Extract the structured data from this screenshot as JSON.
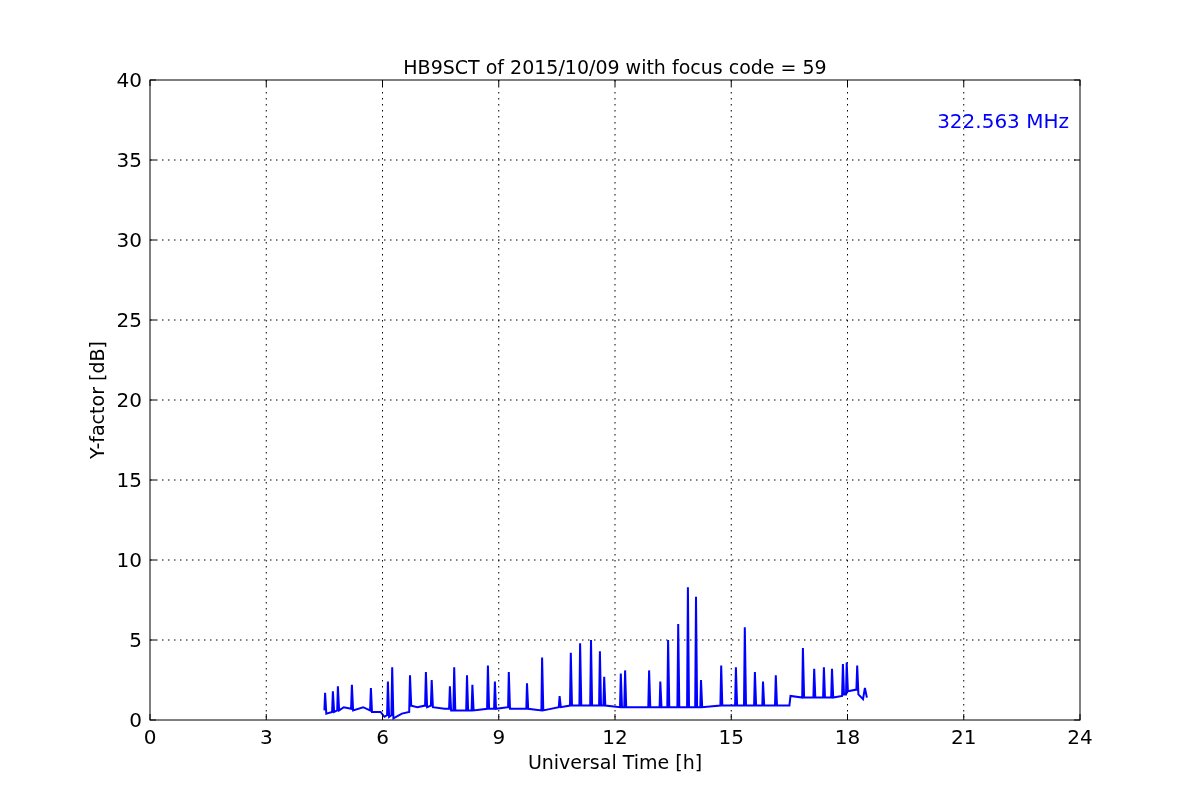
{
  "chart_data": {
    "type": "line",
    "title": "HB9SCT of 2015/10/09 with focus code = 59",
    "xlabel": "Universal Time [h]",
    "ylabel": "Y-factor [dB]",
    "xlim": [
      0,
      24
    ],
    "ylim": [
      0,
      40
    ],
    "grid": true,
    "xticks": [
      0,
      3,
      6,
      9,
      12,
      15,
      18,
      21,
      24
    ],
    "yticks": [
      0,
      5,
      10,
      15,
      20,
      25,
      30,
      35,
      40
    ],
    "x": [
      4.5,
      4.52,
      4.55,
      4.7,
      4.72,
      4.75,
      4.83,
      4.85,
      4.88,
      5.0,
      5.19,
      5.21,
      5.24,
      5.5,
      5.68,
      5.7,
      5.73,
      5.95,
      6.05,
      6.12,
      6.14,
      6.17,
      6.23,
      6.25,
      6.28,
      6.5,
      6.69,
      6.71,
      6.74,
      6.9,
      7.1,
      7.12,
      7.15,
      7.25,
      7.27,
      7.3,
      7.6,
      7.72,
      7.74,
      7.77,
      7.83,
      7.85,
      7.88,
      8.16,
      8.18,
      8.21,
      8.3,
      8.32,
      8.35,
      8.7,
      8.72,
      8.75,
      8.88,
      8.9,
      8.93,
      9.24,
      9.26,
      9.29,
      9.71,
      9.73,
      9.76,
      10.1,
      10.12,
      10.15,
      10.55,
      10.57,
      10.6,
      10.84,
      10.86,
      10.89,
      11.08,
      11.1,
      11.13,
      11.36,
      11.38,
      11.41,
      11.59,
      11.61,
      11.64,
      11.7,
      11.72,
      11.75,
      12.13,
      12.15,
      12.18,
      12.24,
      12.26,
      12.29,
      12.86,
      12.88,
      12.91,
      13.15,
      13.17,
      13.2,
      13.35,
      13.37,
      13.4,
      13.61,
      13.63,
      13.66,
      13.86,
      13.88,
      13.91,
      14.07,
      14.09,
      14.12,
      14.2,
      14.22,
      14.25,
      14.72,
      14.74,
      14.77,
      15.1,
      15.12,
      15.15,
      15.33,
      15.35,
      15.38,
      15.59,
      15.61,
      15.64,
      15.8,
      15.82,
      15.85,
      16.13,
      16.15,
      16.18,
      16.5,
      16.53,
      16.83,
      16.85,
      16.88,
      17.12,
      17.14,
      17.17,
      17.37,
      17.39,
      17.42,
      17.58,
      17.6,
      17.63,
      17.86,
      17.88,
      17.91,
      17.96,
      17.98,
      18.01,
      18.23,
      18.25,
      18.28,
      18.4,
      18.45,
      18.5
    ],
    "series": [
      {
        "name": "322.563 MHz",
        "color": "#0000ff",
        "values": [
          0.6,
          1.7,
          0.4,
          0.5,
          1.8,
          0.5,
          0.6,
          2.1,
          0.6,
          0.8,
          0.7,
          2.2,
          0.6,
          0.8,
          0.6,
          2.0,
          0.5,
          0.5,
          0.2,
          0.3,
          2.4,
          0.2,
          0.3,
          3.3,
          0.1,
          0.4,
          0.5,
          2.8,
          0.9,
          0.8,
          0.9,
          3.0,
          0.8,
          0.9,
          2.5,
          0.8,
          0.7,
          0.7,
          2.1,
          0.6,
          0.6,
          3.3,
          0.6,
          0.6,
          2.8,
          0.6,
          0.6,
          2.2,
          0.6,
          0.7,
          3.4,
          0.7,
          0.7,
          2.4,
          0.7,
          0.8,
          3.0,
          0.7,
          0.7,
          2.3,
          0.7,
          0.6,
          3.9,
          0.6,
          0.8,
          1.5,
          0.8,
          0.9,
          4.2,
          0.9,
          0.9,
          4.8,
          0.9,
          0.9,
          5.0,
          0.9,
          0.9,
          4.3,
          0.9,
          0.9,
          2.7,
          0.9,
          0.8,
          2.9,
          0.8,
          0.8,
          3.1,
          0.8,
          0.8,
          3.1,
          0.8,
          0.8,
          2.4,
          0.8,
          0.8,
          5.0,
          0.8,
          0.8,
          6.0,
          0.8,
          0.8,
          8.3,
          0.8,
          0.8,
          7.7,
          0.8,
          0.8,
          2.5,
          0.8,
          0.9,
          3.4,
          0.9,
          0.9,
          3.3,
          0.9,
          0.9,
          5.8,
          0.9,
          0.9,
          3.0,
          0.9,
          0.9,
          2.4,
          0.9,
          0.9,
          2.8,
          0.9,
          0.9,
          1.5,
          1.4,
          4.5,
          1.4,
          1.4,
          3.2,
          1.4,
          1.4,
          3.3,
          1.4,
          1.4,
          3.2,
          1.4,
          1.5,
          3.5,
          1.6,
          1.6,
          3.6,
          1.8,
          1.9,
          3.4,
          1.6,
          1.3,
          2.0,
          1.4
        ]
      }
    ]
  }
}
